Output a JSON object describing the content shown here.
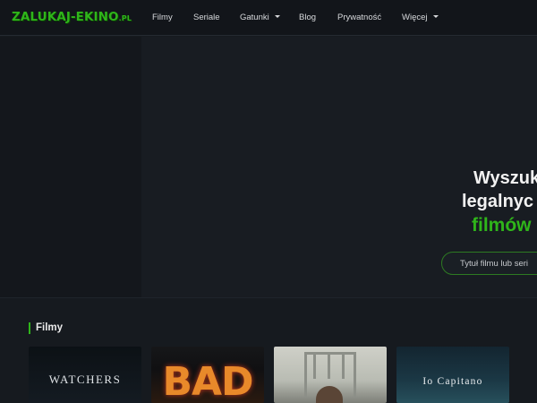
{
  "header": {
    "logo_text": "ZALUKAJ-EKINO",
    "logo_tld": ".PL",
    "nav": [
      {
        "label": "Filmy",
        "dropdown": false
      },
      {
        "label": "Seriale",
        "dropdown": false
      },
      {
        "label": "Gatunki",
        "dropdown": true
      },
      {
        "label": "Blog",
        "dropdown": false
      },
      {
        "label": "Prywatność",
        "dropdown": false
      },
      {
        "label": "Więcej",
        "dropdown": true
      }
    ]
  },
  "hero": {
    "line1": "Wyszuk",
    "line2": "legalnyc",
    "line3": "filmów",
    "search_placeholder": "Tytuł filmu lub seri"
  },
  "section": {
    "title": "Filmy",
    "cards": [
      {
        "poster_text": "WATCHERS"
      },
      {
        "poster_text": "BAD"
      },
      {
        "poster_text": ""
      },
      {
        "poster_text": "Io Capitano"
      }
    ]
  },
  "colors": {
    "accent": "#2fb51a",
    "background": "#161a1f",
    "header_bg": "#12151a"
  }
}
